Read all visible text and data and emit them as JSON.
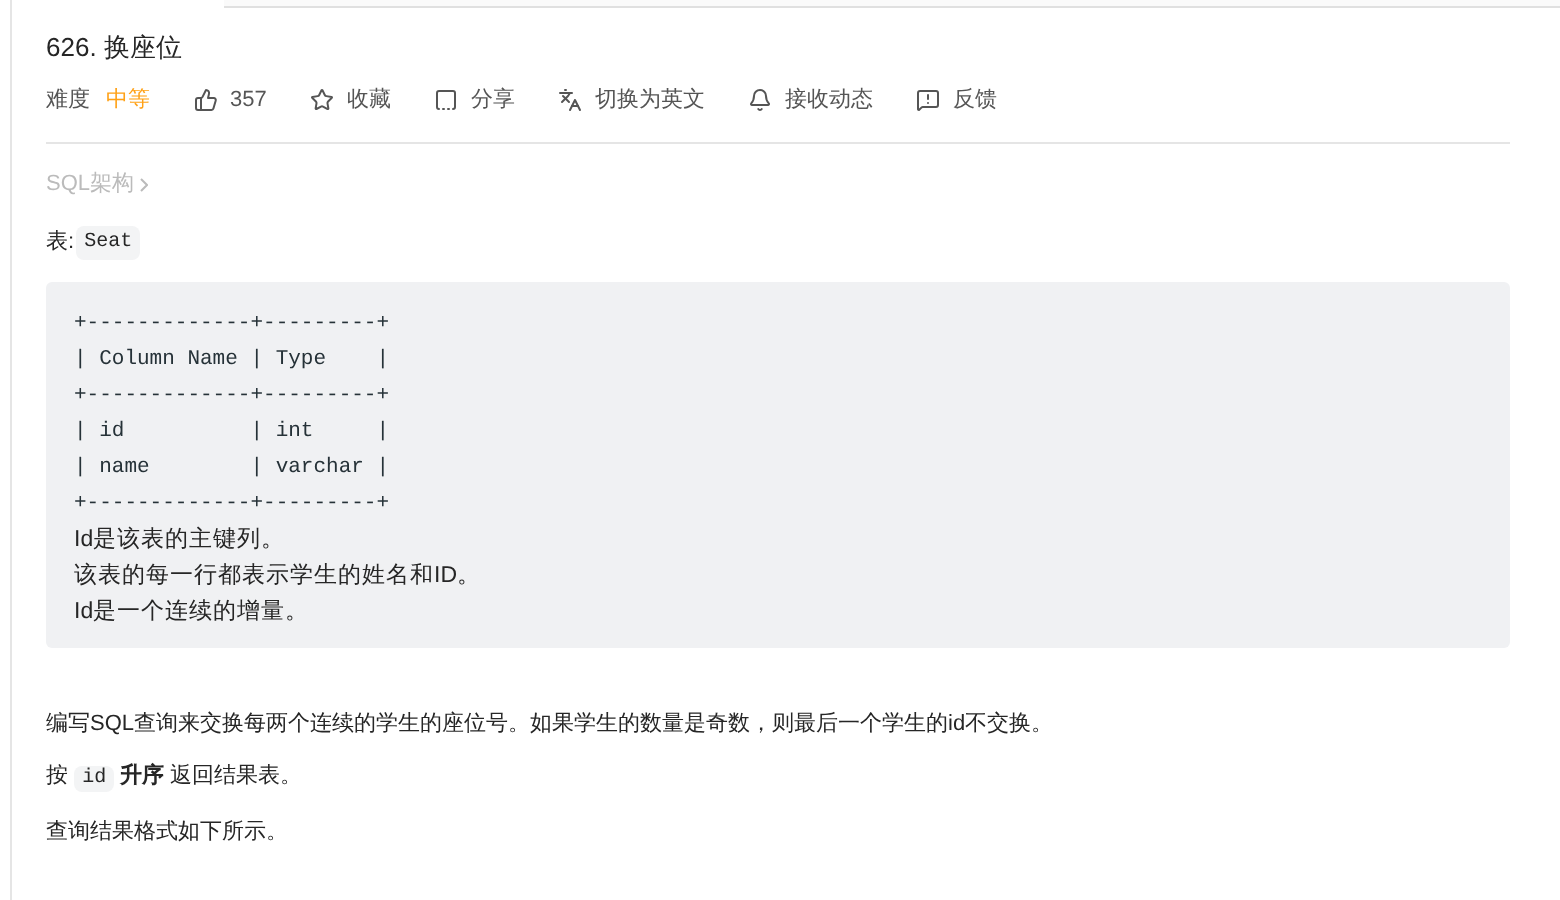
{
  "title": "626. 换座位",
  "difficulty": {
    "label": "难度",
    "value": "中等"
  },
  "actions": [
    {
      "kind": "like",
      "label": "357"
    },
    {
      "kind": "favorite",
      "label": "收藏"
    },
    {
      "kind": "share",
      "label": "分享"
    },
    {
      "kind": "translate",
      "label": "切换为英文"
    },
    {
      "kind": "notify",
      "label": "接收动态"
    },
    {
      "kind": "feedback",
      "label": "反馈"
    }
  ],
  "breadcrumb": "SQL架构",
  "table_label": {
    "text": "表:",
    "code": "Seat"
  },
  "schema_lines": [
    "+-------------+---------+",
    "| Column Name | Type    |",
    "+-------------+---------+",
    "| id          | int     |",
    "| name        | varchar |",
    "+-------------+---------+"
  ],
  "schema_notes": [
    "Id是该表的主键列。",
    "该表的每一行都表示学生的姓名和ID。",
    "Id是一个连续的增量。"
  ],
  "paragraphs": [
    [
      {
        "kind": "text",
        "text": "编写SQL查询来交换每两个连续的学生的座位号。如果学生的数量是奇数，则最后一个学生的id不交换。"
      }
    ],
    [
      {
        "kind": "text",
        "text": "按 "
      },
      {
        "kind": "code",
        "text": "id"
      },
      {
        "kind": "bold",
        "text": " 升序"
      },
      {
        "kind": "text",
        "text": " 返回结果表。"
      }
    ],
    [
      {
        "kind": "text",
        "text": "查询结果格式如下所示。"
      }
    ]
  ]
}
